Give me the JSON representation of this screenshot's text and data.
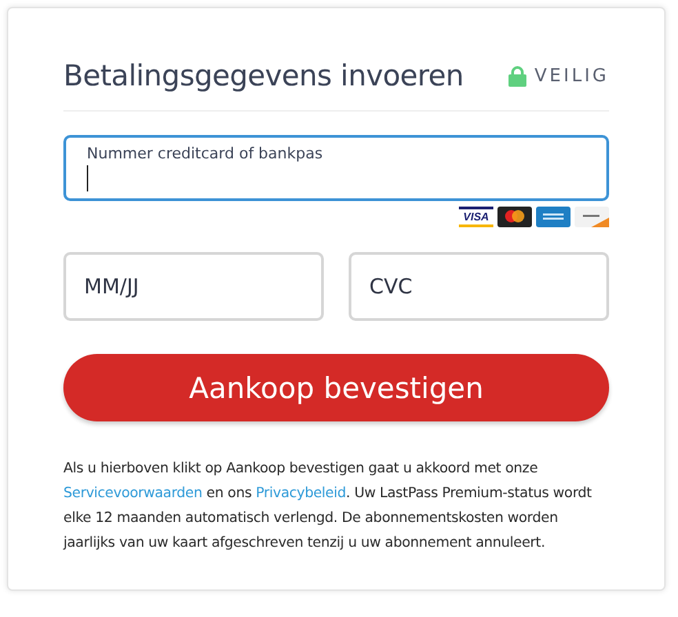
{
  "header": {
    "title": "Betalingsgegevens invoeren",
    "secure_label": "VEILIG"
  },
  "card_number": {
    "label": "Nummer creditcard of bankpas",
    "focused": true
  },
  "card_brands": [
    {
      "kind": "visa",
      "text": "VISA"
    },
    {
      "kind": "mastercard"
    },
    {
      "kind": "amex"
    },
    {
      "kind": "discover"
    }
  ],
  "expiry": {
    "placeholder": "MM/JJ"
  },
  "cvc": {
    "placeholder": "CVC"
  },
  "submit_button": "Aankoop bevestigen",
  "legal": [
    {
      "kind": "text",
      "text": "Als u hierboven klikt op Aankoop bevestigen gaat u akkoord met onze "
    },
    {
      "kind": "link",
      "text": "Servicevoorwaarden"
    },
    {
      "kind": "text",
      "text": " en ons "
    },
    {
      "kind": "link",
      "text": "Privacybeleid"
    },
    {
      "kind": "text",
      "text": ". Uw LastPass Premium-status wordt elke 12 maanden automatisch verlengd. De abonnementskosten worden jaarlijks van uw kaart afgeschreven tenzij u uw abonnement annuleert."
    }
  ]
}
